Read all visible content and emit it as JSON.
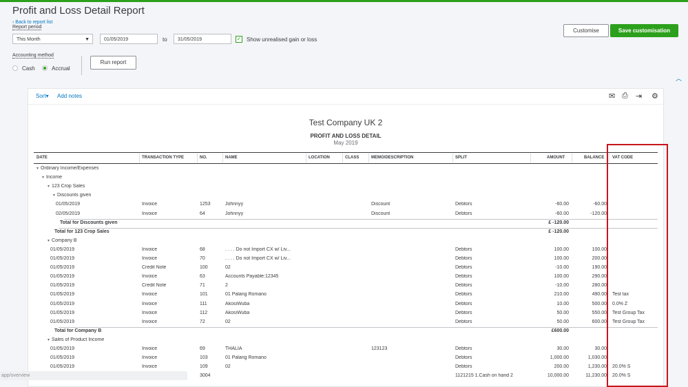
{
  "header": {
    "title": "Profit and Loss Detail Report",
    "back_link": "Back to report list",
    "report_period_label": "Report period",
    "period_select": "This Month",
    "date_from": "01/05/2019",
    "to_label": "to",
    "date_to": "31/05/2019",
    "unrealised_label": "Show unrealised gain or loss",
    "accounting_method_label": "Accounting method",
    "cash_label": "Cash",
    "accrual_label": "Accrual",
    "run_report": "Run report",
    "customise": "Customise",
    "save_customisation": "Save customisation"
  },
  "toolbar": {
    "sort": "Sort",
    "add_notes": "Add notes"
  },
  "report": {
    "company": "Test Company UK 2",
    "title": "PROFIT AND LOSS DETAIL",
    "date": "May 2019"
  },
  "columns": {
    "date": "DATE",
    "type": "TRANSACTION TYPE",
    "no": "NO.",
    "name": "NAME",
    "location": "LOCATION",
    "class": "CLASS",
    "memo": "MEMO/DESCRIPTION",
    "split": "SPLIT",
    "amount": "AMOUNT",
    "balance": "BALANCE",
    "vat": "VAT CODE"
  },
  "rows": [
    {
      "kind": "section",
      "indent": 0,
      "label": "Ordinary Income/Expenses"
    },
    {
      "kind": "section",
      "indent": 1,
      "label": "Income"
    },
    {
      "kind": "section",
      "indent": 2,
      "label": "123 Crop Sales"
    },
    {
      "kind": "section",
      "indent": 3,
      "label": "Discounts given"
    },
    {
      "kind": "data",
      "indent": 4,
      "date": "01/05/2019",
      "type": "Invoice",
      "no": "1253",
      "name": "Johnnyy",
      "memo": "Discount",
      "split": "Debtors",
      "amount": "-60.00",
      "balance": "-60.00",
      "vat": ""
    },
    {
      "kind": "data",
      "indent": 4,
      "date": "02/05/2019",
      "type": "Invoice",
      "no": "64",
      "name": "Johnnyy",
      "memo": "Discount",
      "split": "Debtors",
      "amount": "-60.00",
      "balance": "-120.00",
      "vat": ""
    },
    {
      "kind": "total",
      "indent": 3,
      "label": "Total for Discounts given",
      "amount": "£ -120.00"
    },
    {
      "kind": "total",
      "indent": 2,
      "label": "Total for 123 Crop Sales",
      "amount": "£ -120.00"
    },
    {
      "kind": "section",
      "indent": 2,
      "label": "Company B"
    },
    {
      "kind": "data",
      "indent": 3,
      "date": "01/05/2019",
      "type": "Invoice",
      "no": "68",
      "name": ". . . . Do not Import CX w/ Liv...",
      "memo": "",
      "split": "Debtors",
      "amount": "100.00",
      "balance": "100.00",
      "vat": ""
    },
    {
      "kind": "data",
      "indent": 3,
      "date": "01/05/2019",
      "type": "Invoice",
      "no": "70",
      "name": ". . . . Do not Import CX w/ Liv...",
      "memo": "",
      "split": "Debtors",
      "amount": "100.00",
      "balance": "200.00",
      "vat": ""
    },
    {
      "kind": "data",
      "indent": 3,
      "date": "01/05/2019",
      "type": "Credit Note",
      "no": "100",
      "name": "02",
      "memo": "",
      "split": "Debtors",
      "amount": "-10.00",
      "balance": "190.00",
      "vat": ""
    },
    {
      "kind": "data",
      "indent": 3,
      "date": "01/05/2019",
      "type": "Invoice",
      "no": "63",
      "name": "Accounts Payable:12345",
      "memo": "",
      "split": "Debtors",
      "amount": "100.00",
      "balance": "290.00",
      "vat": ""
    },
    {
      "kind": "data",
      "indent": 3,
      "date": "01/05/2019",
      "type": "Credit Note",
      "no": "71",
      "name": "2",
      "memo": "",
      "split": "Debtors",
      "amount": "-10.00",
      "balance": "280.00",
      "vat": ""
    },
    {
      "kind": "data",
      "indent": 3,
      "date": "01/05/2019",
      "type": "Invoice",
      "no": "101",
      "name": "01 Palang Romano",
      "memo": "",
      "split": "Debtors",
      "amount": "210.00",
      "balance": "490.00",
      "vat": "Test tax"
    },
    {
      "kind": "data",
      "indent": 3,
      "date": "01/05/2019",
      "type": "Invoice",
      "no": "111",
      "name": "AkosiWuba",
      "memo": "",
      "split": "Debtors",
      "amount": "10.00",
      "balance": "500.00",
      "vat": "0.0% Z"
    },
    {
      "kind": "data",
      "indent": 3,
      "date": "01/05/2019",
      "type": "Invoice",
      "no": "112",
      "name": "AkosiWuba",
      "memo": "",
      "split": "Debtors",
      "amount": "50.00",
      "balance": "550.00",
      "vat": "Test Group Tax"
    },
    {
      "kind": "data",
      "indent": 3,
      "date": "01/05/2019",
      "type": "Invoice",
      "no": "72",
      "name": "02",
      "memo": "",
      "split": "Debtors",
      "amount": "50.00",
      "balance": "600.00",
      "vat": "Test Group Tax"
    },
    {
      "kind": "total",
      "indent": 2,
      "label": "Total for Company B",
      "amount": "£600.00"
    },
    {
      "kind": "section",
      "indent": 2,
      "label": "Sales of Product Income"
    },
    {
      "kind": "data",
      "indent": 3,
      "date": "01/05/2019",
      "type": "Invoice",
      "no": "69",
      "name": "THALIA",
      "memo": "123123",
      "split": "Debtors",
      "amount": "30.00",
      "balance": "30.00",
      "vat": ""
    },
    {
      "kind": "data",
      "indent": 3,
      "date": "01/05/2019",
      "type": "Invoice",
      "no": "103",
      "name": "01 Palang Romano",
      "memo": "",
      "split": "Debtors",
      "amount": "1,000.00",
      "balance": "1,030.00",
      "vat": ""
    },
    {
      "kind": "data",
      "indent": 3,
      "date": "01/05/2019",
      "type": "Invoice",
      "no": "109",
      "name": "02",
      "memo": "",
      "split": "Debtors",
      "amount": "200.00",
      "balance": "1,230.00",
      "vat": "20.0% S"
    },
    {
      "kind": "data",
      "indent": 3,
      "date": "",
      "type": "",
      "no": "3004",
      "name": "",
      "memo": "",
      "split": "1121215 1.Cash on hand 2",
      "amount": "10,000.00",
      "balance": "11,230.00",
      "vat": "20.0% S"
    }
  ],
  "status_url": "app/overview"
}
